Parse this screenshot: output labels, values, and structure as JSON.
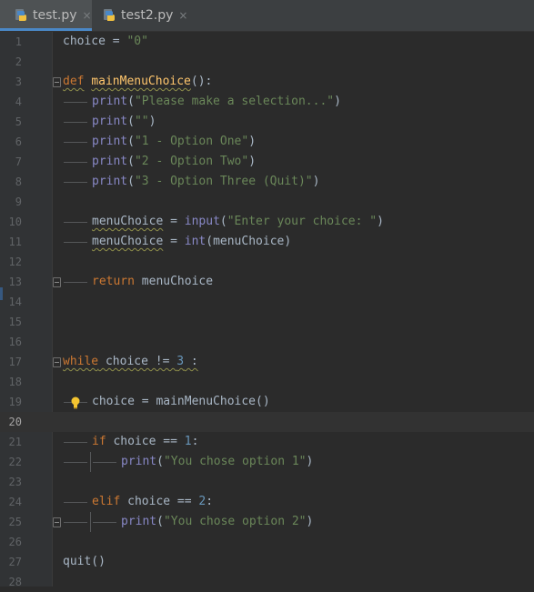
{
  "tabs": [
    {
      "label": "test.py",
      "close": "×",
      "active": true
    },
    {
      "label": "test2.py",
      "close": "×",
      "active": false
    }
  ],
  "editor": {
    "current_line": 20,
    "line_numbers": [
      "1",
      "2",
      "3",
      "4",
      "5",
      "6",
      "7",
      "8",
      "9",
      "10",
      "11",
      "12",
      "13",
      "14",
      "15",
      "16",
      "17",
      "18",
      "19",
      "20",
      "21",
      "22",
      "23",
      "24",
      "25",
      "26",
      "27",
      "28"
    ],
    "tokens": {
      "l1_a": "choice = ",
      "l1_b": "\"0\"",
      "l3_kw": "def",
      "l3_fn": "mainMenuChoice",
      "l3_rest": "():",
      "print": "print",
      "l4_s": "\"Please make a selection...\"",
      "l5_s": "\"\"",
      "l6_s": "\"1 - Option One\"",
      "l7_s": "\"2 - Option Two\"",
      "l8_s": "\"3 - Option Three (Quit)\"",
      "menuChoice": "menuChoice",
      "eq": " = ",
      "input": "input",
      "l10_s": "\"Enter your choice: \"",
      "int": "int",
      "l11_arg": "(menuChoice)",
      "return": "return",
      "l13_rest": " menuChoice",
      "while": "while",
      "l17_a": " choice != ",
      "l17_n": "3",
      "l17_b": " :",
      "l19": "choice = mainMenuChoice()",
      "if": "if",
      "l21_a": " choice == ",
      "l21_n": "1",
      "colon": ":",
      "l22_s": "\"You chose option 1\"",
      "elif": "elif",
      "l24_a": " choice == ",
      "l24_n": "2",
      "l25_s": "\"You chose option 2\"",
      "l27": "quit()",
      "lparen": "(",
      "rparen": ")"
    }
  },
  "colors": {
    "background": "#2b2b2b",
    "keyword": "#cc7832",
    "string": "#6a8759",
    "number": "#6897bb",
    "function": "#ffc66d",
    "builtin": "#8888c6",
    "text": "#a9b7c6"
  },
  "icons": [
    "python-file-icon",
    "lightbulb-icon",
    "fold-marker-icon"
  ]
}
